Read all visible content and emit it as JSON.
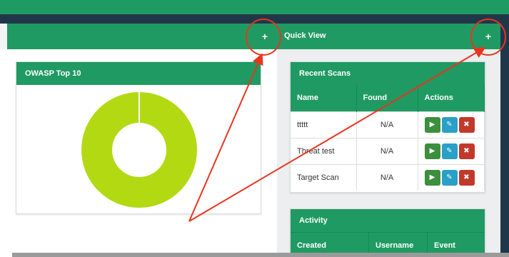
{
  "header": {
    "left_plus": "+",
    "quick_view_title": "Quick View",
    "right_plus": "+"
  },
  "owasp_panel": {
    "title": "OWASP Top 10",
    "chart_data": {
      "type": "pie",
      "donut": true,
      "values": [
        100
      ],
      "colors": [
        "#b3d913"
      ]
    }
  },
  "recent_scans": {
    "title": "Recent Scans",
    "columns": [
      "Name",
      "Found",
      "Actions"
    ],
    "rows": [
      {
        "name": "ttttt",
        "found": "N/A"
      },
      {
        "name": "Threat test",
        "found": "N/A"
      },
      {
        "name": "Target Scan",
        "found": "N/A"
      }
    ],
    "action_icons": [
      "play-icon",
      "pencil-icon",
      "x-icon"
    ]
  },
  "activity": {
    "title": "Activity",
    "columns": [
      "Created",
      "Username",
      "Event"
    ]
  },
  "colors": {
    "primary": "#1f9a63",
    "dark": "#20374a",
    "annotation": "#e8351f",
    "donut": "#b3d913",
    "run": "#3c8f3c",
    "edit": "#2a9fc7",
    "delete": "#c0392b"
  }
}
